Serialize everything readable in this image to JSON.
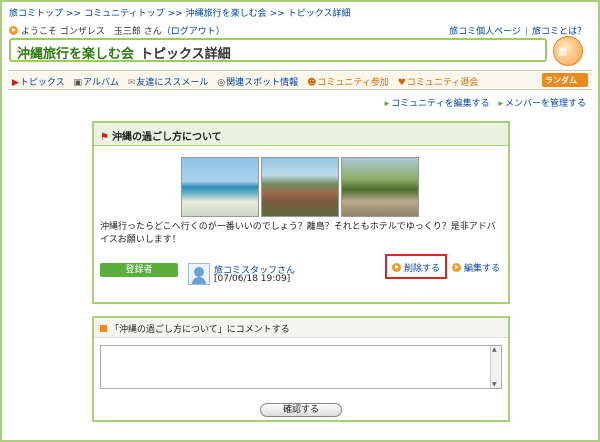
{
  "breadcrumb": {
    "items": [
      "旅コミトップ",
      "コミュニティトップ",
      "沖縄旅行を楽しむ会",
      "トピックス詳細"
    ],
    "sep": ">>"
  },
  "welcome": {
    "prefix": "ようこそ ゴンザレス　玉三郎 さん",
    "logout": "（ログアウト）"
  },
  "top_links": {
    "personal": "旅コミ個人ページ",
    "sep": "|",
    "about": "旅コミとは？"
  },
  "title": {
    "community": "沖縄旅行を楽しむ会",
    "page": "トピックス詳細"
  },
  "logo": {
    "text": "旅"
  },
  "nav": {
    "items": [
      {
        "icon": "flag-icon",
        "glyph": "▶",
        "label": "トピックス"
      },
      {
        "icon": "camera-icon",
        "glyph": "▣",
        "label": "アルバム"
      },
      {
        "icon": "mail-icon",
        "glyph": "✉",
        "label": "友達にススメール"
      },
      {
        "icon": "compass-icon",
        "glyph": "◎",
        "label": "関連スポット情報"
      },
      {
        "icon": "people-icon",
        "glyph": "☻",
        "label": "コミュニティ参加"
      },
      {
        "icon": "heart-icon",
        "glyph": "♥",
        "label": "コミュニティ退会"
      }
    ],
    "random": "ランダム"
  },
  "sub_links": {
    "edit": "コミュニティを編集する",
    "manage": "メンバーを管理する"
  },
  "topic": {
    "title": "沖縄の過ごし方について",
    "message": "沖縄行ったらどこへ行くのが一番いいのでしょう？離島？それともホテルでゆっくり？是非アドバイスお願いします！",
    "registrant_label": "登録者",
    "author": "旅コミスタッフさん",
    "date": "[07/06/18 19:09]",
    "delete": "削除する",
    "edit": "編集する"
  },
  "comment": {
    "heading": "「沖縄の過ごし方について」にコメントする",
    "value": "",
    "confirm": "確認する"
  }
}
